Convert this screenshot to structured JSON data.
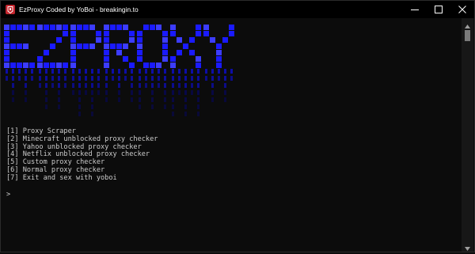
{
  "window": {
    "title": "EzProxy Coded by YoBoi - breakingin.to",
    "app_icon": "app-logo-icon",
    "controls": [
      "minimize-icon",
      "maximize-icon",
      "close-icon"
    ]
  },
  "banner": {
    "text": "EZPROXY",
    "colors": {
      "primary": "#1a1aff",
      "bright": "#3c3cff",
      "drip": "#0d0da8",
      "dim": "#07075c"
    }
  },
  "menu": {
    "items": [
      {
        "label": "[1] Proxy Scraper"
      },
      {
        "label": "[2] Minecraft unblocked proxy checker"
      },
      {
        "label": "[3] Yahoo unblocked proxy checker"
      },
      {
        "label": "[4] Netflix unblocked proxy checker"
      },
      {
        "label": "[5] Custom proxy checker"
      },
      {
        "label": "[6] Normal proxy checker"
      },
      {
        "label": "[7] Exit and sex with yoboi"
      }
    ]
  },
  "prompt": {
    "symbol": ">"
  },
  "colors": {
    "console_bg": "#0c0c0c",
    "console_text": "#cccccc",
    "titlebar_bg": "#000000",
    "titlebar_text": "#ffffff",
    "app_icon": "#c4262e"
  }
}
